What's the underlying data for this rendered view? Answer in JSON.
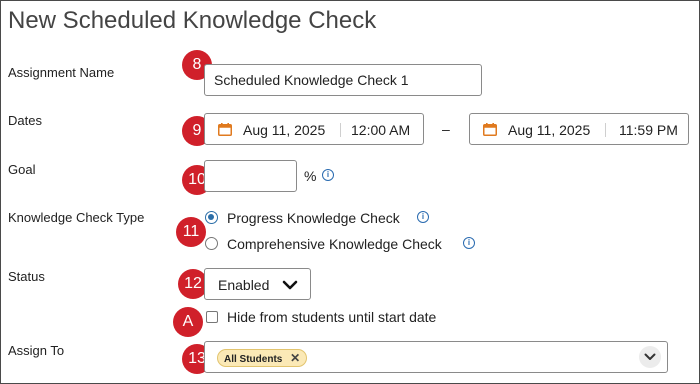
{
  "page": {
    "title": "New Scheduled Knowledge Check"
  },
  "markers": {
    "name": "8",
    "dates": "9",
    "goal": "10",
    "type": "11",
    "status": "12",
    "hide": "A",
    "assign": "13"
  },
  "fields": {
    "assignment_name": {
      "label": "Assignment Name",
      "value": "Scheduled Knowledge Check 1"
    },
    "dates": {
      "label": "Dates",
      "start_date": "Aug 11, 2025",
      "start_time": "12:00 AM",
      "separator": "–",
      "end_date": "Aug 11, 2025",
      "end_time": "11:59 PM"
    },
    "goal": {
      "label": "Goal",
      "value": "",
      "unit": "%"
    },
    "type": {
      "label": "Knowledge Check Type",
      "options": [
        {
          "label": "Progress Knowledge Check",
          "selected": true
        },
        {
          "label": "Comprehensive Knowledge Check",
          "selected": false
        }
      ]
    },
    "status": {
      "label": "Status",
      "value": "Enabled",
      "hide_label": "Hide from students until start date",
      "hide_checked": false
    },
    "assign_to": {
      "label": "Assign To",
      "chips": [
        {
          "label": "All Students"
        }
      ]
    }
  },
  "icons": {
    "calendar": "calendar-icon",
    "info": "info-icon",
    "chevron": "chevron-down-icon",
    "remove": "close-icon"
  },
  "colors": {
    "marker": "#d0202a",
    "calendar": "#e07a1f",
    "info": "#2a6bb0",
    "radio": "#2b6ea8",
    "chip": "#fbe9b6"
  }
}
